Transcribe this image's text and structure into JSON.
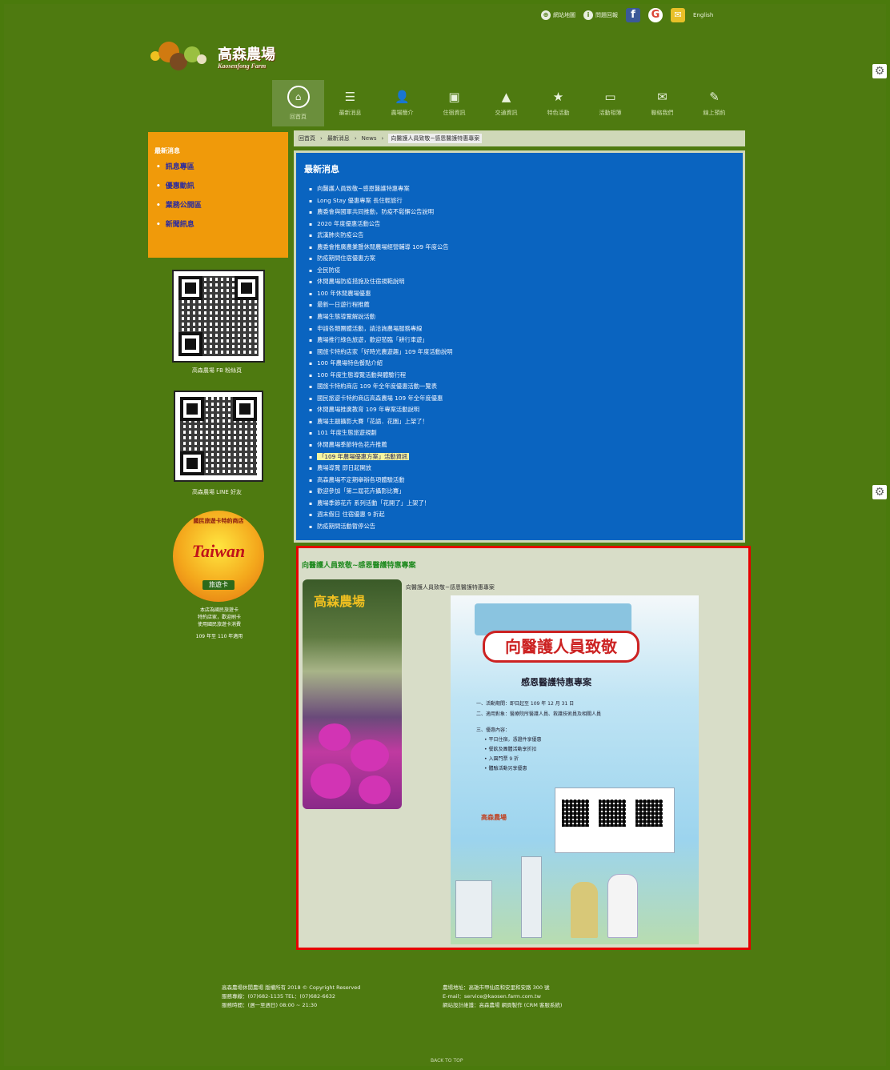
{
  "top_links": [
    {
      "icon": "globe-icon",
      "label": "網站地圖"
    },
    {
      "icon": "info-icon",
      "label": "問題回報"
    }
  ],
  "top_lang": "English",
  "logo": {
    "name": "高森農場",
    "sub": "Kaosenfong Farm"
  },
  "nav": [
    {
      "label": "回首頁",
      "icon": "home-icon",
      "active": true
    },
    {
      "label": "最新消息",
      "icon": "list-icon"
    },
    {
      "label": "農場簡介",
      "icon": "person-icon"
    },
    {
      "label": "住宿資訊",
      "icon": "bed-icon"
    },
    {
      "label": "交通資訊",
      "icon": "road-icon"
    },
    {
      "label": "特色活動",
      "icon": "star-icon"
    },
    {
      "label": "活動相簿",
      "icon": "photo-icon"
    },
    {
      "label": "聯絡我們",
      "icon": "mail-icon"
    },
    {
      "label": "線上預約",
      "icon": "edit-icon"
    }
  ],
  "sidebar": {
    "title": "最新消息",
    "items": [
      "訊息專區",
      "優惠動訊",
      "業務公開區",
      "新聞訊息"
    ]
  },
  "qr1_caption": "高森農場 FB 粉絲頁",
  "qr2_caption": "高森農場 LINE 好友",
  "badge": {
    "ring": "國民旅遊卡特約商店",
    "title": "Taiwan",
    "label": "旅遊卡"
  },
  "badge_caption": [
    "本店為國民旅遊卡",
    "特約店家，歡迎刷卡",
    "使用國民旅遊卡消費",
    "109 年至 110 年適用"
  ],
  "breadcrumb": [
    "回首頁",
    "最新消息",
    "News",
    "向醫護人員致敬~感恩醫護特惠專案"
  ],
  "news": {
    "title": "最新消息",
    "items": [
      "向醫護人員致敬~感恩醫護特惠專案",
      "Long Stay 優惠專案 長住輕旅行",
      "農委會與國軍共同推動，防疫不鬆懈公告說明",
      "2020 年度優惠活動公告",
      "武漢肺炎防疫公告",
      "農委會推廣農業暨休閒農場經營輔導 109 年度公告",
      "防疫期間住宿優惠方案",
      "全民防疫",
      "休閒農場防疫措施及住宿規範說明",
      "100 年休閒農場優惠",
      "最新一日遊行程推薦",
      "農場生態導覽解說活動",
      "申請各類團體活動，請洽詢農場服務專線",
      "農場推行綠色旅遊，歡迎蒞臨「耕行車遊」",
      "國旅卡特約店家「好時光農遊趣」109 年度活動說明",
      "100 年農場特色餐點介紹",
      "100 年度生態導覽活動與體驗行程",
      "國旅卡特約商店 109 年全年度優惠活動一覽表",
      "國民旅遊卡特約商店高森農場 109 年全年度優惠",
      "休閒農場推廣教育 109 年專案活動說明",
      "農場主題攝影大賽「花語．花園」上架了！",
      "101 年度生態旅遊規劃",
      "休閒農場季節特色花卉推薦",
      "「109 年農場優惠方案」活動資訊",
      "農場導覽 即日起開放",
      "高森農場不定期舉辦各項體驗活動",
      "歡迎參加「第二屆花卉攝影比賽」",
      "農場季節花卉 系列活動「花開了」上架了！",
      "週末假日 住宿優惠 9 折起",
      "防疫期間活動暫停公告"
    ],
    "highlight_index": 23
  },
  "article": {
    "title": "向醫護人員致敬~感恩醫護特惠專案",
    "subtitle": "向醫護人員致敬~感恩醫護特惠專案",
    "photo_caption": "高森農場",
    "poster": {
      "headline": "向醫護人員致敬",
      "subhead": "感恩醫護特惠專案",
      "bullets": [
        "一、活動期間：即日起至 109 年 12 月 31 日",
        "二、適用對象：醫療院所醫護人員、救護技術員及相關人員",
        "三、優惠內容：",
        "• 平日住宿，憑證件享優惠",
        "• 餐飲及團體活動享折扣",
        "• 入園門票 9 折",
        "• 體驗活動另享優惠"
      ],
      "logo_text": "高森農場"
    }
  },
  "footer": {
    "left": [
      "高森農場休閒農場 版權所有 2018 © Copyright Reserved",
      "服務專線：(07)682-1135  TEL：(07)682-6632",
      "服務時間：(週一至週日) 08:00 ~ 21:30"
    ],
    "right": [
      "農場地址：高雄市甲仙區和安里和安路 300 號",
      "E-mail：service@kaosen.farm.com.tw",
      "網站設計維護：高森農場 網頁製作 (CRM 客服系統)"
    ]
  },
  "totop": "BACK TO TOP"
}
